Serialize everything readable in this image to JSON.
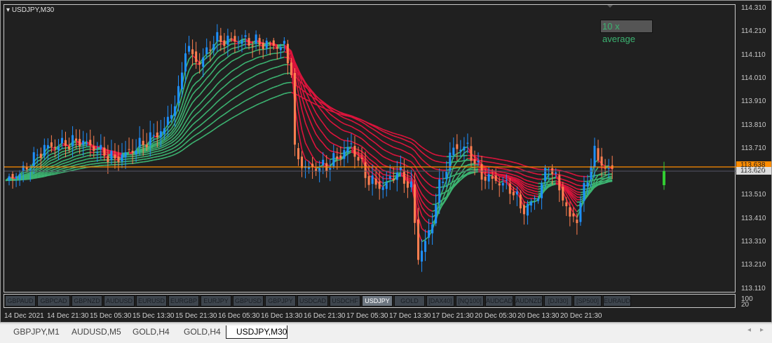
{
  "chart_title": "USDJPY,M30",
  "indicator_label": "10 x average",
  "price_axis": [
    "114.310",
    "114.210",
    "114.110",
    "114.010",
    "113.910",
    "113.810",
    "113.710",
    "113.610",
    "113.510",
    "113.410",
    "113.310",
    "113.210",
    "113.110"
  ],
  "current_price_orange": "113.638",
  "current_price": "113.620",
  "lower_axis": [
    "100",
    "20"
  ],
  "time_axis": [
    "14 Dec 2021",
    "14 Dec 21:30",
    "15 Dec 05:30",
    "15 Dec 13:30",
    "15 Dec 21:30",
    "16 Dec 05:30",
    "16 Dec 13:30",
    "16 Dec 21:30",
    "17 Dec 05:30",
    "17 Dec 13:30",
    "17 Dec 21:30",
    "20 Dec 05:30",
    "20 Dec 13:30",
    "20 Dec 21:30"
  ],
  "symbol_buttons": [
    "GBPAUD",
    "GBPCAD",
    "GBPNZD",
    "AUDUSD",
    "EURUSD",
    "EURGBP",
    "EURJPY",
    "GBPUSD",
    "GBPJPY",
    "USDCAD",
    "USDCHF",
    "USDJPY",
    "GOLD",
    "[DAX40]",
    "[NQ100]",
    "AUDCAD",
    "AUDNZD",
    "[DJI30]",
    "[SP500]",
    "EURAUD"
  ],
  "active_symbol": "USDJPY",
  "tabs": [
    "GBPJPY,M1",
    "AUDUSD,M5",
    "GOLD,H4",
    "GOLD,H4",
    "USDJPY,M30"
  ],
  "active_tab": 4,
  "colors": {
    "bull": "#1e90ff",
    "bear": "#ff7f50",
    "ma_up": "#3cb371",
    "ma_down": "#dc143c",
    "bid": "#ff8c00"
  },
  "chart_data": {
    "type": "candlestick",
    "ylim": [
      113.11,
      114.31
    ],
    "close_path": [
      [
        0,
        113.58
      ],
      [
        5,
        113.62
      ],
      [
        11,
        113.72
      ],
      [
        21,
        113.75
      ],
      [
        31,
        113.67
      ],
      [
        37,
        113.72
      ],
      [
        45,
        113.8
      ],
      [
        49,
        113.95
      ],
      [
        51,
        114.15
      ],
      [
        55,
        114.08
      ],
      [
        59,
        114.18
      ],
      [
        67,
        114.18
      ],
      [
        79,
        114.15
      ],
      [
        81,
        114.05
      ],
      [
        82,
        113.7
      ],
      [
        85,
        113.63
      ],
      [
        91,
        113.64
      ],
      [
        98,
        113.73
      ],
      [
        103,
        113.58
      ],
      [
        107,
        113.55
      ],
      [
        111,
        113.62
      ],
      [
        115,
        113.55
      ],
      [
        117,
        113.25
      ],
      [
        120,
        113.35
      ],
      [
        123,
        113.55
      ],
      [
        127,
        113.72
      ],
      [
        131,
        113.72
      ],
      [
        135,
        113.6
      ],
      [
        139,
        113.58
      ],
      [
        143,
        113.55
      ],
      [
        147,
        113.45
      ],
      [
        151,
        113.52
      ],
      [
        154,
        113.65
      ],
      [
        157,
        113.55
      ],
      [
        160,
        113.42
      ],
      [
        162,
        113.42
      ],
      [
        165,
        113.6
      ],
      [
        167,
        113.7
      ],
      [
        170,
        113.63
      ],
      [
        172,
        113.62
      ]
    ]
  }
}
